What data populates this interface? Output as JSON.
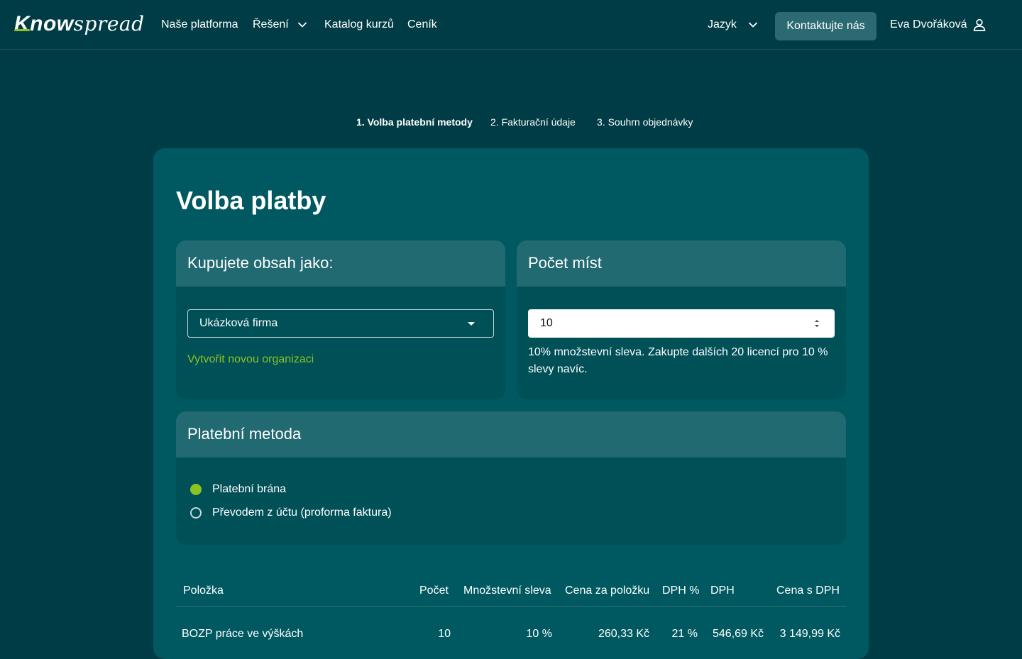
{
  "brand": {
    "logo_bold": "Know",
    "logo_light": "spread",
    "accent": "#8dc21f"
  },
  "nav": {
    "items": [
      "Naše platforma",
      "Řešení",
      "Katalog kurzů",
      "Ceník"
    ],
    "language_label": "Jazyk",
    "contact_label": "Kontaktujte nás",
    "user_name": "Eva Dvořáková"
  },
  "steps": [
    {
      "label": "1. Volba platební metody",
      "active": true
    },
    {
      "label": "2. Fakturační údaje",
      "active": false
    },
    {
      "label": "3. Souhrn objednávky",
      "active": false
    }
  ],
  "page_title": "Volba platby",
  "buyer_panel": {
    "title": "Kupujete obsah jako:",
    "selected_org": "Ukázková firma",
    "create_org_link": "Vytvořit novou organizaci"
  },
  "seats_panel": {
    "title": "Počet míst",
    "value": "10",
    "note": "10% množstevní sleva. Zakupte dalších 20 licencí pro 10 % slevy navíc."
  },
  "payment_panel": {
    "title": "Platební metoda",
    "options": [
      {
        "label": "Platební brána",
        "checked": true
      },
      {
        "label": "Převodem z účtu (proforma faktura)",
        "checked": false
      }
    ]
  },
  "table": {
    "headers": [
      "Položka",
      "Počet",
      "Množstevní sleva",
      "Cena za položku",
      "DPH %",
      "DPH",
      "Cena s DPH"
    ],
    "rows": [
      [
        "BOZP práce ve výškách",
        "10",
        "10 %",
        "260,33 Kč",
        "21 %",
        "546,69 Kč",
        "3 149,99 Kč"
      ]
    ]
  }
}
